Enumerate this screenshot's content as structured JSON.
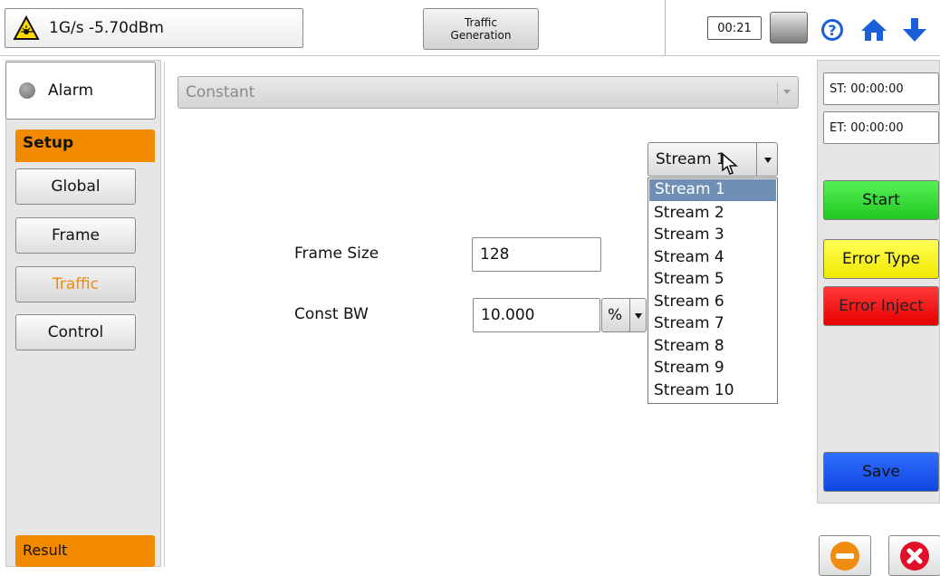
{
  "topbar": {
    "rate_status": "1G/s -5.70dBm",
    "title": "Traffic\nGeneration",
    "clock": "00:21",
    "icons": [
      "laser-warning-icon",
      "battery-icon",
      "help-icon",
      "home-icon",
      "download-arrow-icon"
    ]
  },
  "sidebar": {
    "alarm_label": "Alarm",
    "setup_label": "Setup",
    "items": [
      {
        "label": "Global",
        "active": false
      },
      {
        "label": "Frame",
        "active": false
      },
      {
        "label": "Traffic",
        "active": true
      },
      {
        "label": "Control",
        "active": false
      }
    ],
    "result_label": "Result",
    "active_color": "#f08a10",
    "tab_color": "#f28a00"
  },
  "main": {
    "traffic_mode": "Constant",
    "stream_select": "Stream 1",
    "stream_options": [
      "Stream 1",
      "Stream 2",
      "Stream 3",
      "Stream 4",
      "Stream 5",
      "Stream 6",
      "Stream 7",
      "Stream 8",
      "Stream 9",
      "Stream 10"
    ],
    "selected_stream_index": 0,
    "frame_size_label": "Frame Size",
    "frame_size_value": "128",
    "const_bw_label": "Const BW",
    "const_bw_value": "10.000",
    "bw_unit": "%"
  },
  "right": {
    "start_time": "ST: 00:00:00",
    "end_time": "ET: 00:00:00",
    "start_label": "Start",
    "error_type_label": "Error Type",
    "error_inject_label": "Error Inject",
    "save_label": "Save",
    "colors": {
      "start": "#33dd33",
      "error_type": "#f8f020",
      "error_inject": "#f01010",
      "save": "#1f5cf5"
    }
  }
}
